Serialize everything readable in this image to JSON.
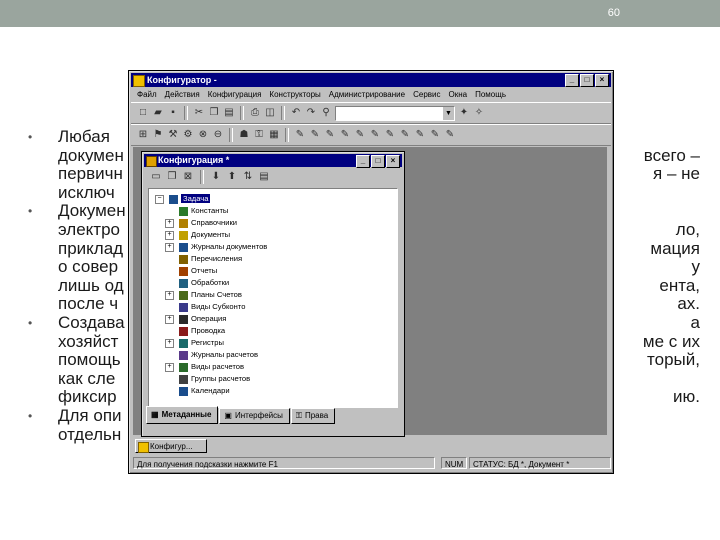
{
  "slide": {
    "number": "60"
  },
  "bullets": [
    {
      "left": "Любая",
      "right": ""
    },
    {
      "left": "докумен",
      "right": "всего –"
    },
    {
      "left": "первичн",
      "right": "я – не"
    },
    {
      "left": "исключ",
      "right": ""
    },
    {
      "left": "Докумен",
      "right": ""
    },
    {
      "left": "электро",
      "right": "ло,"
    },
    {
      "left": "приклад",
      "right": "мация"
    },
    {
      "left": "о совер",
      "right": "у"
    },
    {
      "left": "лишь од",
      "right": "ента,"
    },
    {
      "left": "после ч",
      "right": "ах."
    },
    {
      "left": "Создава",
      "right": "а"
    },
    {
      "left": "хозяйст",
      "right": "ме с их"
    },
    {
      "left": "помощь",
      "right": "торый,"
    },
    {
      "left": "как сле",
      "right": ""
    },
    {
      "left": "фиксир",
      "right": "ию."
    },
    {
      "left": "Для опи",
      "right": ""
    },
    {
      "left": "отдельн",
      "right": ""
    }
  ],
  "window": {
    "title": "Конфигуратор -",
    "buttons": {
      "minimize": "_",
      "maximize": "□",
      "close": "×"
    },
    "menu": [
      "Файл",
      "Действия",
      "Конфигурация",
      "Конструкторы",
      "Администрирование",
      "Сервис",
      "Окна",
      "Помощь"
    ]
  },
  "inner": {
    "title": "Конфигурация *",
    "tree": [
      {
        "label": "Задача",
        "root": true,
        "plus": false
      },
      {
        "label": "Константы",
        "plus": false
      },
      {
        "label": "Справочники",
        "plus": true
      },
      {
        "label": "Документы",
        "plus": true
      },
      {
        "label": "Журналы документов",
        "plus": true
      },
      {
        "label": "Перечисления",
        "plus": false
      },
      {
        "label": "Отчеты",
        "plus": false
      },
      {
        "label": "Обработки",
        "plus": false
      },
      {
        "label": "Планы Счетов",
        "plus": true
      },
      {
        "label": "Виды Субконто",
        "plus": false
      },
      {
        "label": "Операция",
        "plus": true
      },
      {
        "label": "Проводка",
        "plus": false
      },
      {
        "label": "Регистры",
        "plus": true
      },
      {
        "label": "Журналы расчетов",
        "plus": false
      },
      {
        "label": "Виды расчетов",
        "plus": true
      },
      {
        "label": "Группы расчетов",
        "plus": false
      },
      {
        "label": "Календари",
        "plus": false
      }
    ],
    "tabs": [
      "Метаданные",
      "Интерфейсы",
      "Права"
    ]
  },
  "taskbar": {
    "item": "Конфигур..."
  },
  "statusbar": {
    "hint": "Для получения подсказки нажмите F1",
    "num": "NUM",
    "status": "СТАТУС: БД *, Документ *"
  },
  "colors": {
    "topbar": "#9aa59e",
    "titlebar": "#000080",
    "window": "#c0c0c0",
    "mdi": "#808080"
  }
}
